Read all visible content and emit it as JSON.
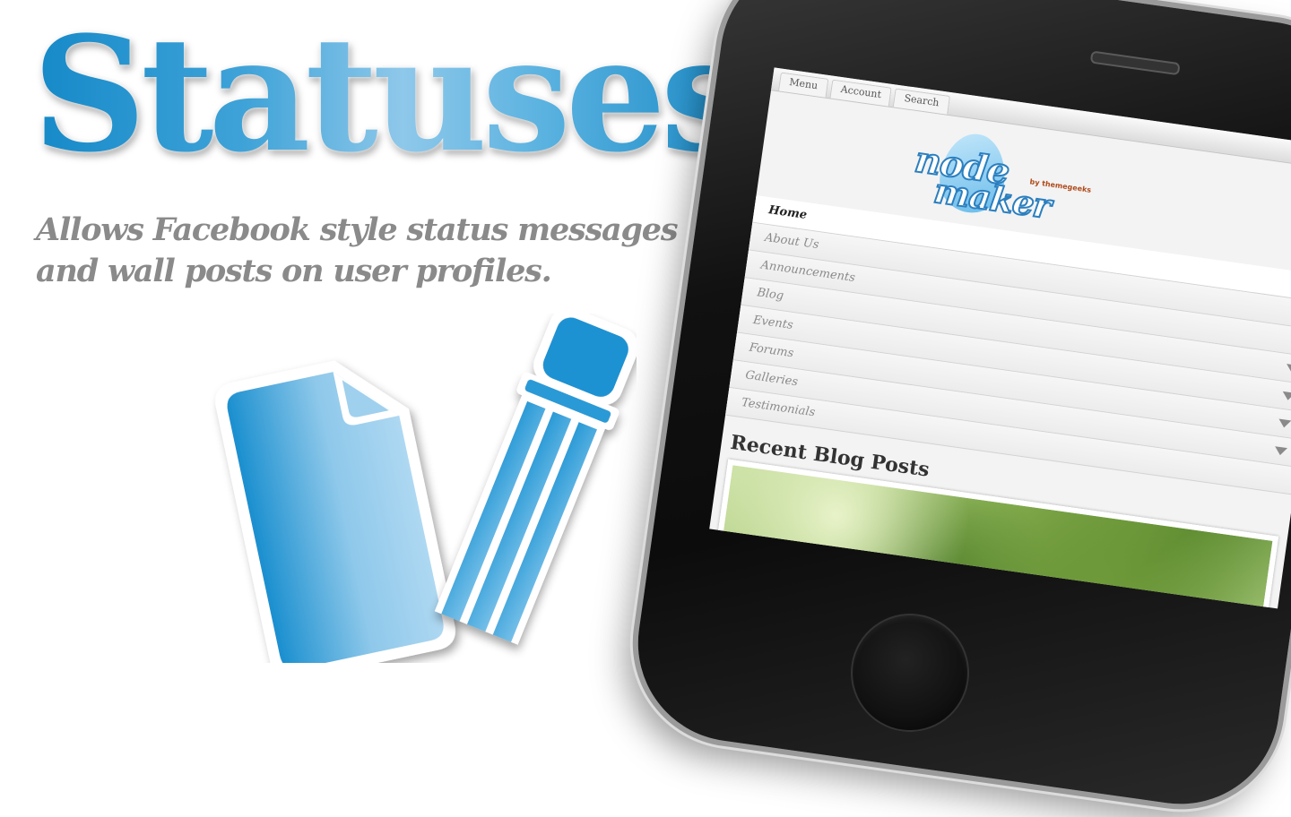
{
  "hero": {
    "title": "Statuses",
    "tagline_line1": "Allows Facebook style status messages",
    "tagline_line2": "and wall posts on user profiles."
  },
  "colors": {
    "title_blue_dark": "#1589c8",
    "title_blue_light": "#8ec8ea",
    "tagline_gray": "#8a8a8a",
    "phone_body": "#111111"
  },
  "icons": {
    "main_graphic": "document-pencil-icon"
  },
  "phone_screen": {
    "top_tabs": [
      "Menu",
      "Account",
      "Search"
    ],
    "logo": {
      "line1": "node",
      "line2": "maker",
      "by": "by themegeeks"
    },
    "menu_items": [
      {
        "label": "Home",
        "active": true,
        "has_submenu": false
      },
      {
        "label": "About Us",
        "active": false,
        "has_submenu": false
      },
      {
        "label": "Announcements",
        "active": false,
        "has_submenu": false
      },
      {
        "label": "Blog",
        "active": false,
        "has_submenu": true
      },
      {
        "label": "Events",
        "active": false,
        "has_submenu": true
      },
      {
        "label": "Forums",
        "active": false,
        "has_submenu": true
      },
      {
        "label": "Galleries",
        "active": false,
        "has_submenu": true
      },
      {
        "label": "Testimonials",
        "active": false,
        "has_submenu": false
      }
    ],
    "recent_posts_heading": "Recent Blog Posts"
  }
}
